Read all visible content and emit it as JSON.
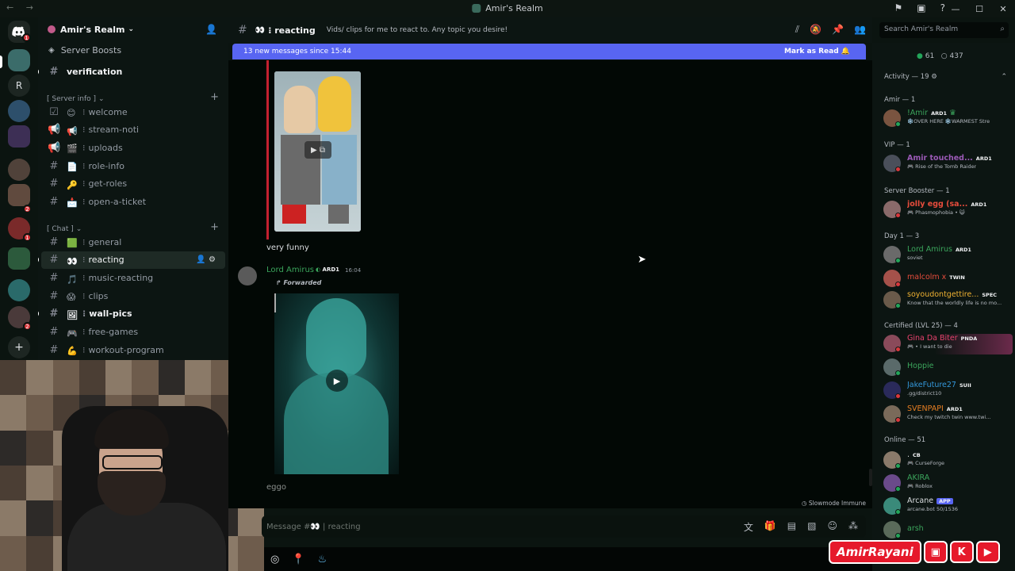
{
  "window": {
    "title": "Amir's Realm",
    "nav": "← →",
    "icons": [
      "flag-icon",
      "screen-icon",
      "help-icon"
    ],
    "controls": [
      "—",
      "☐",
      "✕"
    ]
  },
  "rail": {
    "letter_server": "R",
    "badges": [
      "1",
      "2",
      "1",
      "2"
    ],
    "add_label": "+"
  },
  "guild": {
    "name": "Amir's Realm",
    "server_boosts": "Server Boosts",
    "channels_top": [
      {
        "name": "verification",
        "bold": true
      }
    ],
    "categories": [
      {
        "label": "[ Server info ]",
        "channels": [
          {
            "name": "welcome",
            "emoji": "😊"
          },
          {
            "name": "stream-noti",
            "emoji": "📢"
          },
          {
            "name": "uploads",
            "emoji": "🎬"
          },
          {
            "name": "role-info",
            "emoji": "📄"
          },
          {
            "name": "get-roles",
            "emoji": "🔑"
          },
          {
            "name": "open-a-ticket",
            "emoji": "📩"
          }
        ]
      },
      {
        "label": "[ Chat ]",
        "channels": [
          {
            "name": "general",
            "emoji": "🟩"
          },
          {
            "name": "reacting",
            "emoji": "👀",
            "active": true
          },
          {
            "name": "music-reacting",
            "emoji": "🎵"
          },
          {
            "name": "clips",
            "emoji": "😱"
          },
          {
            "name": "wall-pics",
            "emoji": "🖼",
            "bold": true
          },
          {
            "name": "free-games",
            "emoji": "🎮"
          },
          {
            "name": "workout-program",
            "emoji": "💪"
          }
        ]
      }
    ]
  },
  "channel": {
    "name": "reacting",
    "emoji": "👀",
    "topic": "Vids/ clips for me to react to. Any topic you desire!",
    "search_placeholder": "Search Amir's Realm"
  },
  "new_messages": {
    "text": "13 new messages since 15:44",
    "action": "Mark as Read"
  },
  "messages": [
    {
      "text": "very funny"
    },
    {
      "author": "Lord Amirus",
      "role_tag": "ARD1",
      "time": "16:04",
      "forwarded_label": "Forwarded",
      "followup": "eggo"
    }
  ],
  "slowmode": "Slowmode Immune",
  "composer": {
    "placeholder": "Message #👀 | reacting"
  },
  "members": {
    "online_count": "61",
    "offline_count": "437",
    "groups": [
      {
        "label": "Activity — 19",
        "members": []
      },
      {
        "label": "Amir — 1",
        "members": [
          {
            "name": "!Amir",
            "tag": "ARD1",
            "sub": "❄️OVER HERE ❄️WARMEST Stre",
            "color": "#3ba55c"
          }
        ]
      },
      {
        "label": "VIP — 1",
        "members": [
          {
            "name": "Amir touched...",
            "tag": "ARD1",
            "sub": "Rise of the Tomb Raider",
            "color": "#9b59b6"
          }
        ]
      },
      {
        "label": "Server Booster — 1",
        "members": [
          {
            "name": "jolly egg (sa...",
            "tag": "ARD1",
            "sub": "Phasmophobia • 😺",
            "color": "#e74c3c"
          }
        ]
      },
      {
        "label": "Day 1 — 3",
        "members": [
          {
            "name": "Lord Amirus",
            "tag": "ARD1",
            "sub": "soviet",
            "color": "#3ba55c"
          },
          {
            "name": "malcolm x",
            "tag": "TWIN",
            "sub": "",
            "color": "#e74c3c"
          },
          {
            "name": "soyoudontgettire...",
            "tag": "SPEC",
            "sub": "Know that the worldly life is no mo...",
            "color": "#f0b232"
          }
        ]
      },
      {
        "label": "Certified (LVL 25) — 4",
        "members": [
          {
            "name": "Gina Da Biter",
            "tag": "PNDA",
            "sub": "• I want to die",
            "color": "#e9426e"
          },
          {
            "name": "Hoppie",
            "tag": "",
            "sub": "",
            "color": "#3ba55c"
          },
          {
            "name": "JakeFuture27",
            "tag": "SUII",
            "sub": ".gg/district10",
            "color": "#3498db"
          },
          {
            "name": "SVENPAPI",
            "tag": "ARD1",
            "sub": "Check my twitch twin www.twi...",
            "color": "#e67e22"
          }
        ]
      },
      {
        "label": "Online — 51",
        "members": [
          {
            "name": ".",
            "tag": "CB",
            "sub": "CurseForge",
            "color": "#dbdee1"
          },
          {
            "name": "AKIRA",
            "tag": "",
            "sub": "Roblox",
            "color": "#3ba55c"
          },
          {
            "name": "Arcane",
            "tag": "APP",
            "sub": "arcane.bot 50/1536",
            "color": "#dbdee1"
          },
          {
            "name": "arsh",
            "tag": "",
            "sub": "",
            "color": "#3ba55c"
          }
        ]
      }
    ]
  },
  "brand": {
    "name": "AmirRayani"
  }
}
